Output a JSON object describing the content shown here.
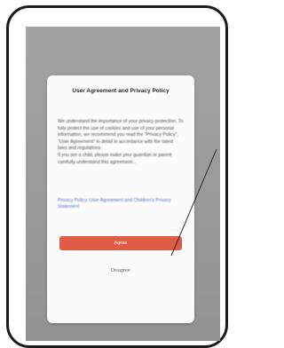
{
  "dialog": {
    "title": "User Agreement and Privacy Policy",
    "paragraph1": "We understand the importance of your privacy protection. To fully protect the use of cookies and use of your personal information, we recommend you read the \"Privacy Policy\", \"User Agreement\" in detail in accordance with the latest laws and regulations.",
    "paragraph2": "If you are a child, please make your guardian or parent carefully understand this agreement...",
    "links": "Privacy Policy, User Agreement and Children's Privacy Statement",
    "agree_label": "Agree",
    "disagree_label": "Disagree"
  },
  "colors": {
    "accent": "#e05b44",
    "link": "#4f6fb8",
    "overlay": "#9a9a9a"
  }
}
